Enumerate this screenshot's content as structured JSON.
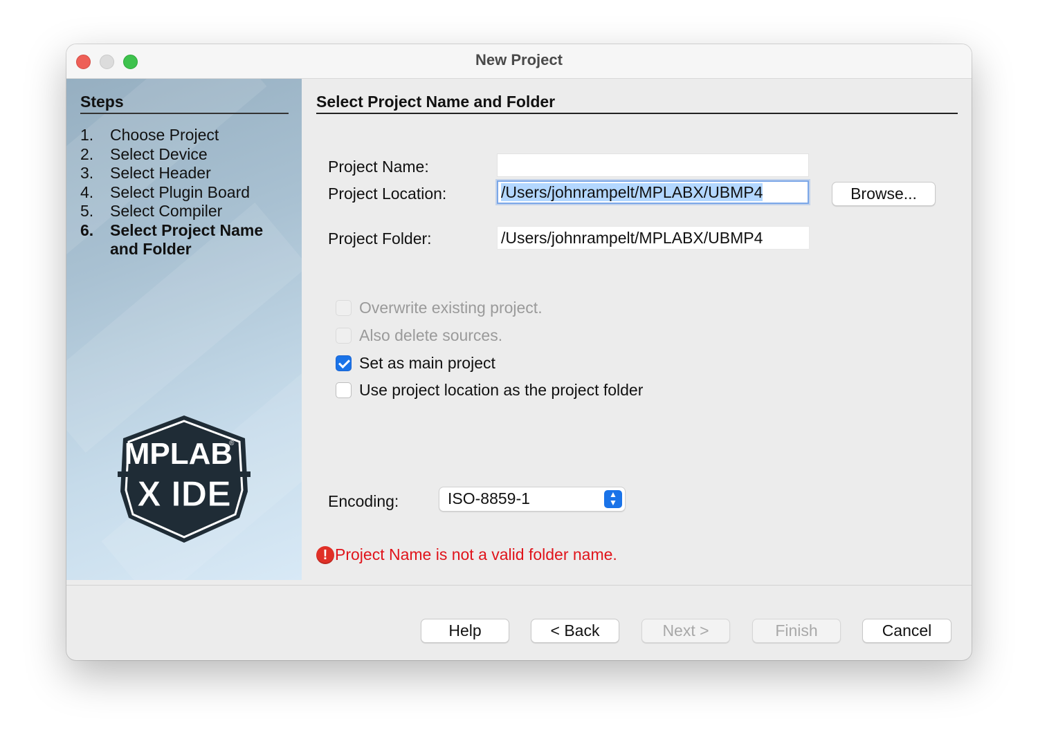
{
  "window": {
    "title": "New Project"
  },
  "sidebar": {
    "title": "Steps",
    "steps": [
      {
        "num": "1.",
        "label": "Choose Project"
      },
      {
        "num": "2.",
        "label": "Select Device"
      },
      {
        "num": "3.",
        "label": "Select Header"
      },
      {
        "num": "4.",
        "label": "Select Plugin Board"
      },
      {
        "num": "5.",
        "label": "Select Compiler"
      },
      {
        "num": "6.",
        "label": "Select Project Name",
        "label2": "and Folder",
        "active": true
      }
    ],
    "logo": {
      "line1": "MPLAB",
      "line2": "X IDE",
      "mark": "®"
    }
  },
  "main": {
    "title": "Select Project Name and Folder",
    "project_name": {
      "label": "Project Name:",
      "value": ""
    },
    "project_location": {
      "label": "Project Location:",
      "value": "/Users/johnrampelt/MPLABX/UBMP4"
    },
    "browse_label": "Browse...",
    "project_folder": {
      "label": "Project Folder:",
      "value": "/Users/johnrampelt/MPLABX/UBMP4"
    },
    "options": [
      {
        "label": "Overwrite existing project.",
        "checked": false,
        "disabled": true
      },
      {
        "label": "Also delete sources.",
        "checked": false,
        "disabled": true
      },
      {
        "label": "Set as main project",
        "checked": true,
        "disabled": false
      },
      {
        "label": "Use project location as the project folder",
        "checked": false,
        "disabled": false
      }
    ],
    "encoding": {
      "label": "Encoding:",
      "value": "ISO-8859-1"
    },
    "error": {
      "icon": "error-icon",
      "message": "Project Name is not a valid folder name."
    }
  },
  "footer": {
    "help": "Help",
    "back": "< Back",
    "next": "Next >",
    "finish": "Finish",
    "cancel": "Cancel"
  },
  "colors": {
    "accent": "#1a73e8",
    "error": "#e0141b",
    "selection": "#b3d7ff"
  }
}
